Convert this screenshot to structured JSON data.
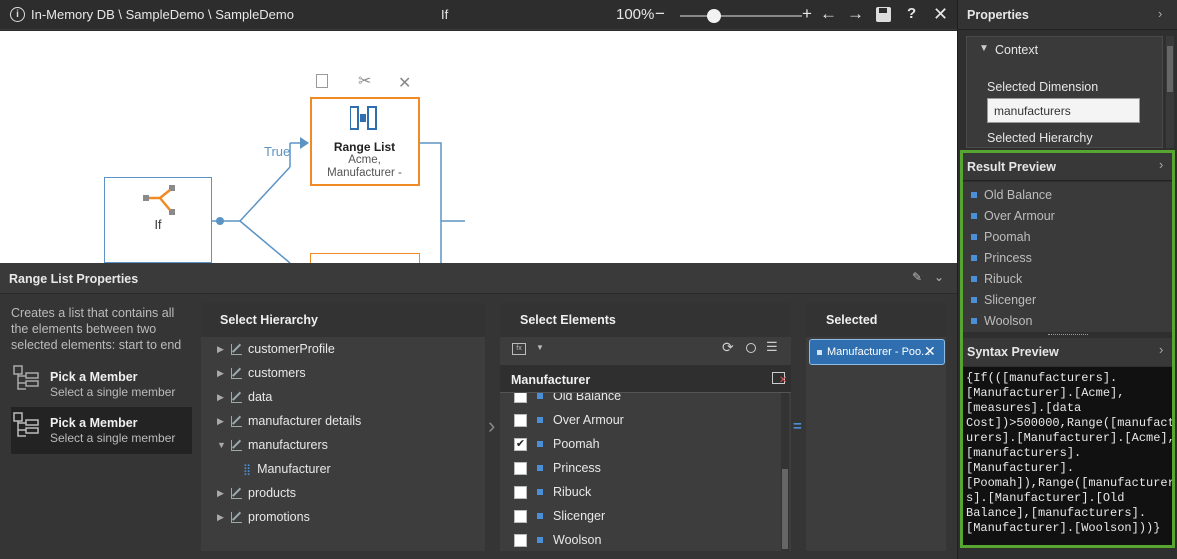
{
  "topbar": {
    "breadcrumb": "In-Memory DB \\ SampleDemo \\ SampleDemo",
    "title": "If",
    "zoom": "100%"
  },
  "canvas": {
    "if_node_label": "If",
    "true_label": "True",
    "range_node": {
      "title": "Range List",
      "line1": "Acme,",
      "line2": "Manufacturer -"
    }
  },
  "properties": {
    "title": "Properties",
    "context_label": "Context",
    "selected_dimension_label": "Selected Dimension",
    "selected_dimension_value": "manufacturers",
    "selected_hierarchy_label": "Selected Hierarchy",
    "result_preview_title": "Result Preview",
    "result_items": [
      "Old Balance",
      "Over Armour",
      "Poomah",
      "Princess",
      "Ribuck",
      "Slicenger",
      "Woolson"
    ],
    "syntax_preview_title": "Syntax Preview",
    "syntax_lines": [
      "{If(([manufacturers].",
      "[Manufacturer].[Acme],",
      "[measures].[data",
      "Cost])>500000,Range([manufact",
      "urers].[Manufacturer].[Acme],",
      "[manufacturers].",
      "[Manufacturer].",
      "[Poomah]),Range([manufacturer",
      "s].[Manufacturer].[Old",
      "Balance],[manufacturers].",
      "[Manufacturer].[Woolson]))}"
    ]
  },
  "bottom": {
    "title": "Range List Properties",
    "description": "Creates a list that contains all the elements between two selected elements: start to end",
    "pick_items": [
      {
        "title": "Pick a Member",
        "subtitle": "Select a single member"
      },
      {
        "title": "Pick a Member",
        "subtitle": "Select a single member"
      }
    ],
    "select_hierarchy_title": "Select Hierarchy",
    "hierarchy_items": [
      {
        "label": "customerProfile",
        "expanded": false
      },
      {
        "label": "customers",
        "expanded": false
      },
      {
        "label": "data",
        "expanded": false
      },
      {
        "label": "manufacturer details",
        "expanded": false
      },
      {
        "label": "manufacturers",
        "expanded": true
      },
      {
        "label": "Manufacturer",
        "child": true
      },
      {
        "label": "products",
        "expanded": false
      },
      {
        "label": "promotions",
        "expanded": false
      }
    ],
    "select_elements_title": "Select Elements",
    "elements_header": "Manufacturer",
    "elements": [
      {
        "label": "Old Balance",
        "checked": false
      },
      {
        "label": "Over Armour",
        "checked": false
      },
      {
        "label": "Poomah",
        "checked": true
      },
      {
        "label": "Princess",
        "checked": false
      },
      {
        "label": "Ribuck",
        "checked": false
      },
      {
        "label": "Slicenger",
        "checked": false
      },
      {
        "label": "Woolson",
        "checked": false
      }
    ],
    "selected_title": "Selected",
    "selected_chip": "Manufacturer - Poo..."
  },
  "colors": {
    "accent_orange": "#f08a24",
    "accent_blue": "#2f6fb0",
    "highlight_green": "#58a632",
    "link_blue": "#4a90d9"
  }
}
